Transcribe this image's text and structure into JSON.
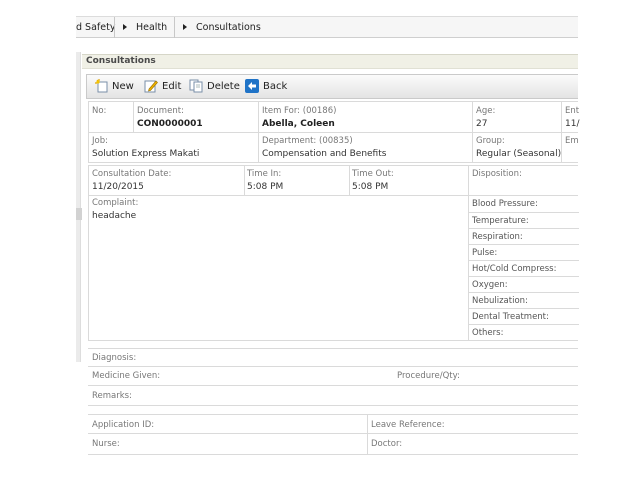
{
  "breadcrumb": {
    "items": [
      "d Safety",
      "Health",
      "Consultations"
    ]
  },
  "panel": {
    "title": "Consultations"
  },
  "toolbar": {
    "new_label": "New",
    "edit_label": "Edit",
    "delete_label": "Delete",
    "back_label": "Back"
  },
  "record": {
    "no_label": "No:",
    "document_label": "Document:",
    "document_value": "CON0000001",
    "item_for_label": "Item For: (00186)",
    "item_for_value": "Abella, Coleen",
    "age_label": "Age:",
    "age_value": "27",
    "entry_label": "Ent",
    "entry_value": "11/",
    "job_label": "Job:",
    "job_value": "Solution Express Makati",
    "department_label": "Department: (00835)",
    "department_value": "Compensation and Benefits",
    "group_label": "Group:",
    "group_value": "Regular (Seasonal)",
    "employee_label": "Em",
    "consultation_date_label": "Consultation Date:",
    "consultation_date_value": "11/20/2015",
    "time_in_label": "Time In:",
    "time_in_value": "5:08 PM",
    "time_out_label": "Time Out:",
    "time_out_value": "5:08 PM",
    "disposition_label": "Disposition:",
    "complaint_label": "Complaint:",
    "complaint_value": "headache",
    "vitals": [
      "Blood Pressure:",
      "Temperature:",
      "Respiration:",
      "Pulse:",
      "Hot/Cold Compress:",
      "Oxygen:",
      "Nebulization:",
      "Dental Treatment:",
      "Others:"
    ],
    "diagnosis_label": "Diagnosis:",
    "medicine_label": "Medicine Given:",
    "procedure_label": "Procedure/Qty:",
    "remarks_label": "Remarks:",
    "application_label": "Application ID:",
    "leave_label": "Leave Reference:",
    "nurse_label": "Nurse:",
    "doctor_label": "Doctor:"
  }
}
